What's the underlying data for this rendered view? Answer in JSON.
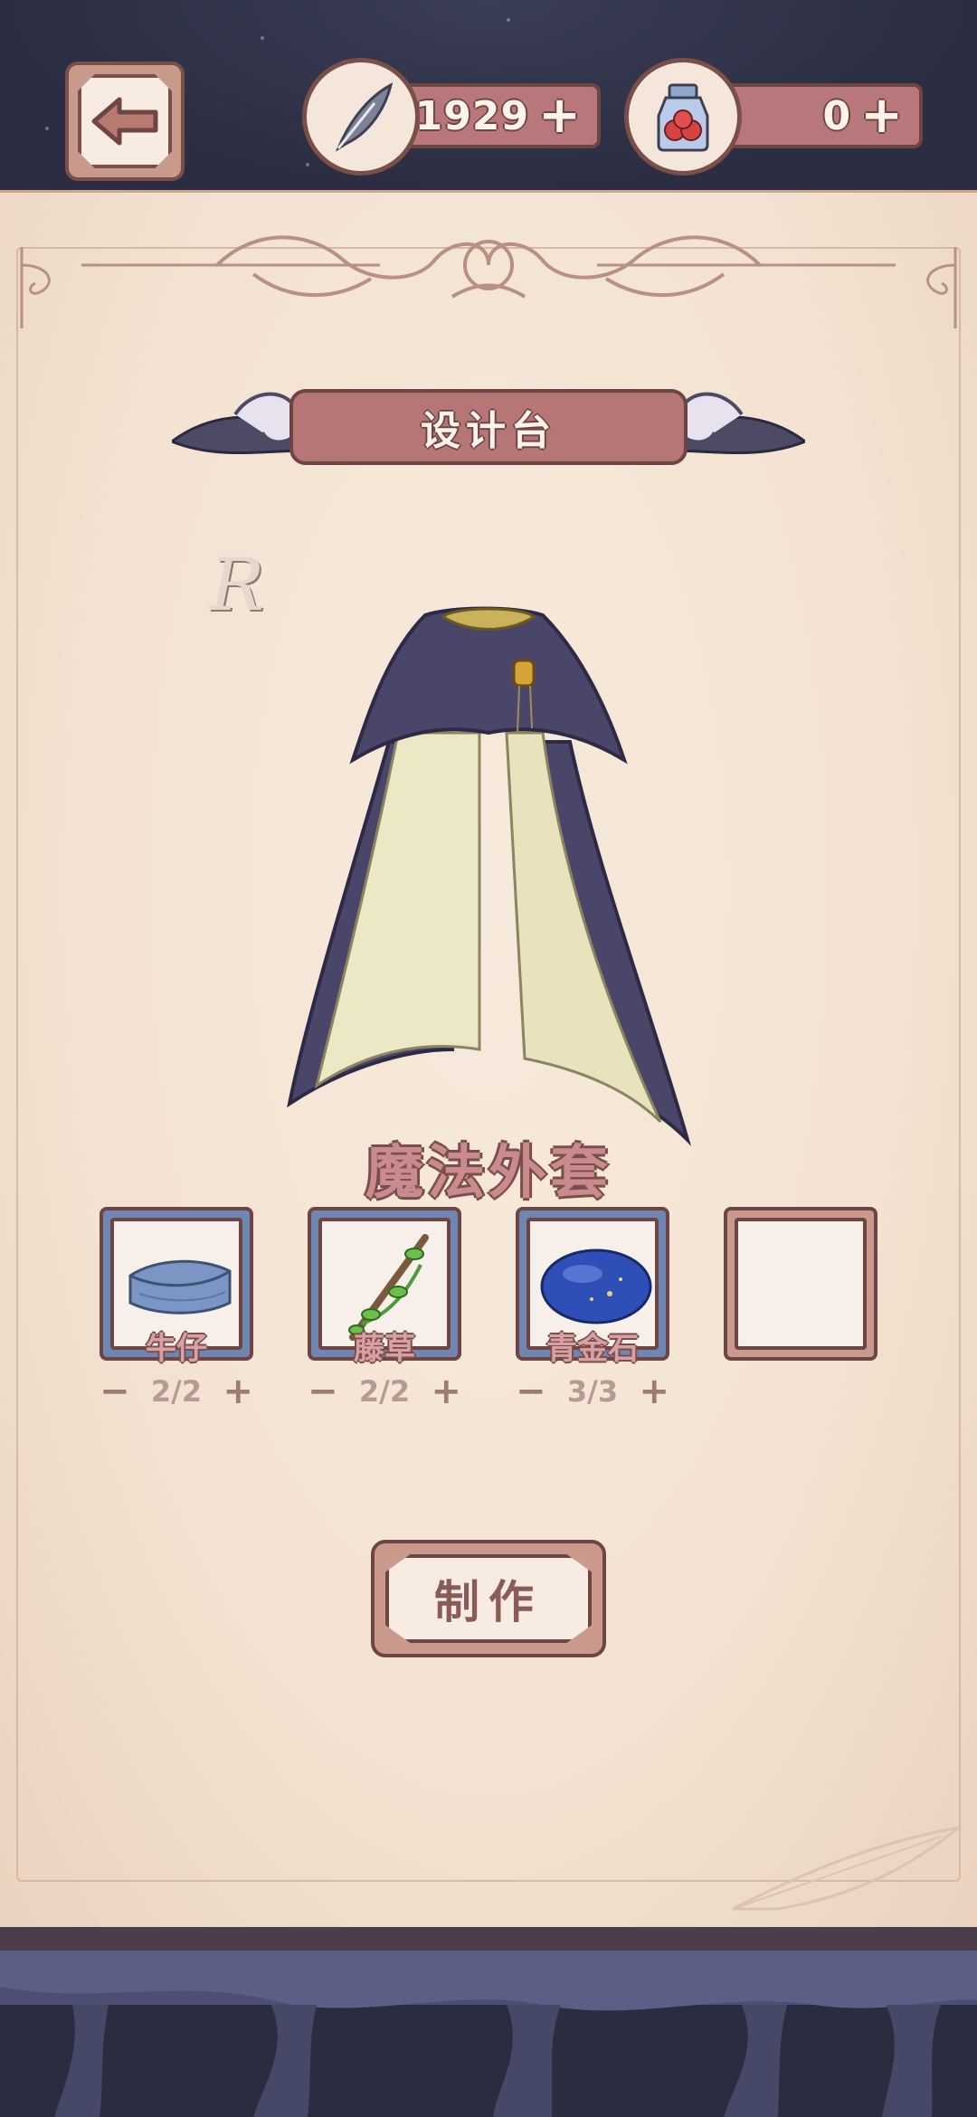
{
  "top_bar": {
    "quill_count": "1929",
    "potion_count": "0",
    "plus_symbol": "+"
  },
  "panel": {
    "title": "设计台",
    "rarity_mark": "R",
    "item_name": "魔法外套",
    "craft_button_label": "制作"
  },
  "materials": [
    {
      "name": "牛仔",
      "icon": "denim-fabric-icon",
      "count": "2/2"
    },
    {
      "name": "藤草",
      "icon": "vine-branch-icon",
      "count": "2/2"
    },
    {
      "name": "青金石",
      "icon": "lapis-stone-icon",
      "count": "3/3"
    },
    {
      "name": "",
      "icon": "",
      "count": ""
    }
  ],
  "colors": {
    "slot_frame_filled": "#6f86b0",
    "slot_frame_empty": "#c99a8c",
    "accent": "#b77676"
  }
}
